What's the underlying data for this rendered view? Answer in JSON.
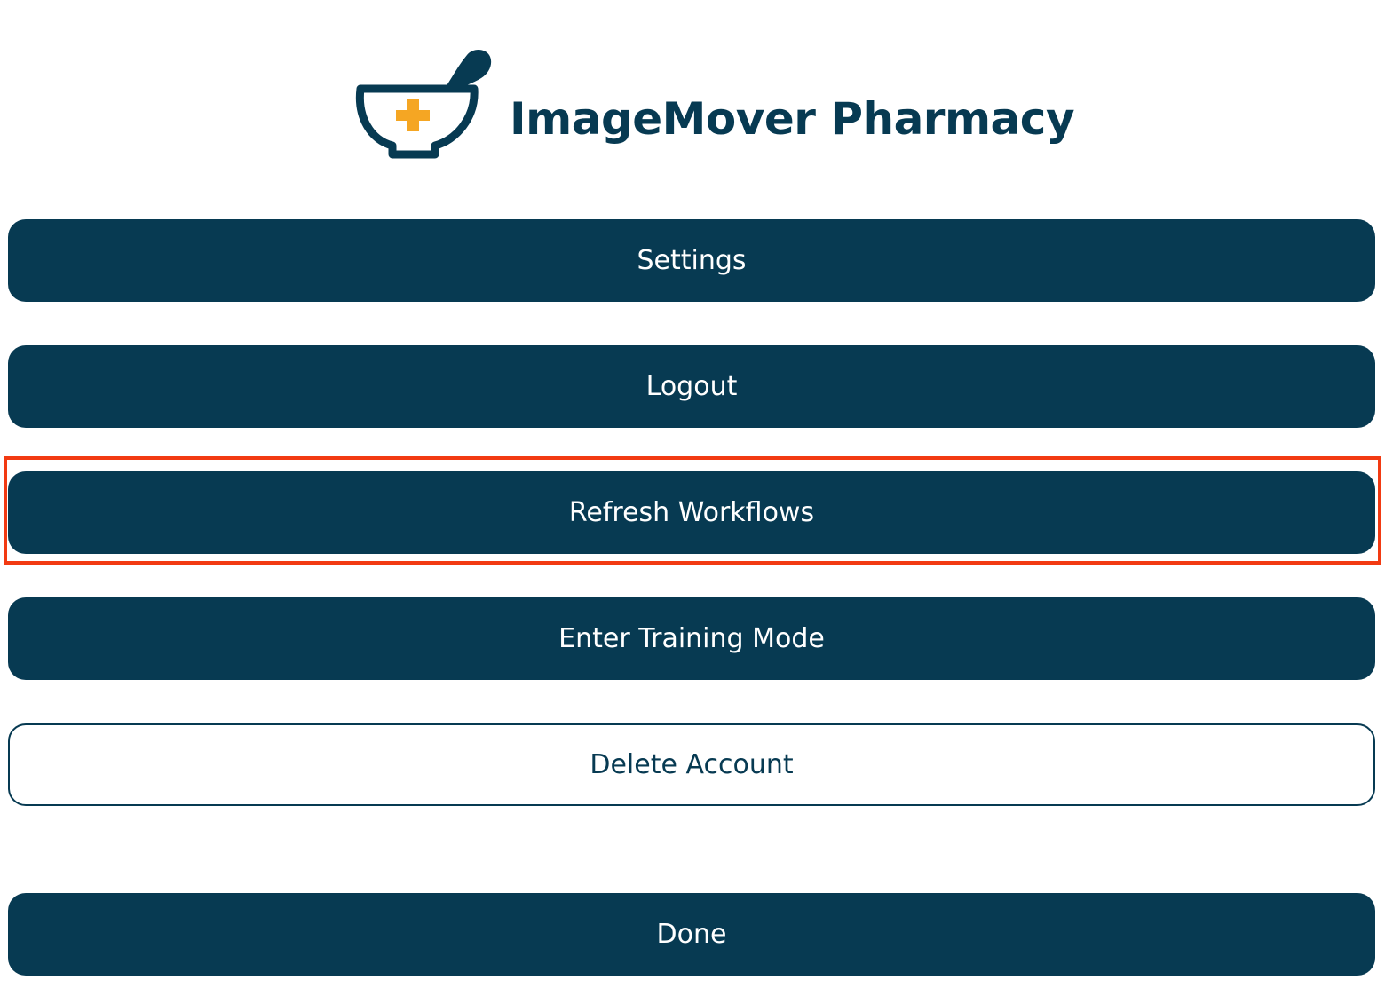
{
  "app": {
    "name": "ImageMover Pharmacy"
  },
  "colors": {
    "brand": "#073a52",
    "button_text": "#ffffff",
    "accent": "#f5a623",
    "highlight": "#f23a12"
  },
  "menu": {
    "settings_label": "Settings",
    "logout_label": "Logout",
    "refresh_workflows_label": "Refresh Workflows",
    "training_mode_label": "Enter Training Mode",
    "delete_account_label": "Delete Account"
  },
  "footer": {
    "done_label": "Done"
  }
}
